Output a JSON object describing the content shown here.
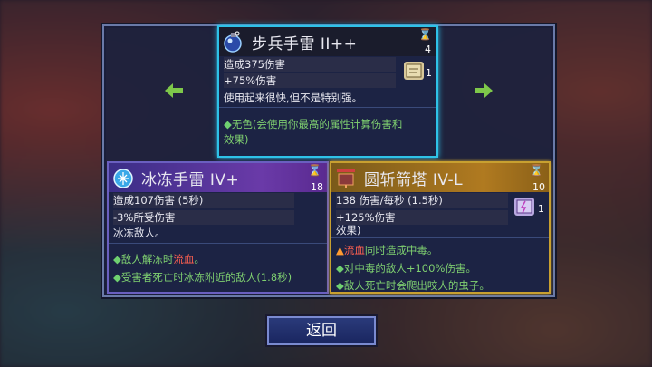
{
  "top_card": {
    "title": "步兵手雷  II++",
    "tier": "4",
    "stat1": "造成375伤害",
    "stat2": "+75%伤害",
    "desc": "使用起来很快,但不是特别强。",
    "scroll_count": "1",
    "note_line1": "无色(会使用你最高的属性计算伤害和",
    "note_line2": "效果)"
  },
  "left_card": {
    "title": "冰冻手雷  IV+",
    "tier": "18",
    "stat1": "造成107伤害 (5秒)",
    "stat2": "-3%所受伤害",
    "desc": "冰冻敌人。",
    "bullet1_a": "敌人解冻时",
    "bullet1_b": "流血",
    "bullet1_c": "。",
    "bullet2": "受害者死亡时冰冻附近的敌人(1.8秒)"
  },
  "right_card": {
    "title": "圆斩箭塔  IV-L",
    "tier": "10",
    "stat1": "138 伤害/每秒 (1.5秒)",
    "stat2": "+125%伤害",
    "desc": "效果)",
    "scroll_count": "1",
    "bullet1_a": "流血",
    "bullet1_b": "同时造成中毒。",
    "bullet2": "对中毒的敌人+100%伤害。",
    "bullet3": "敌人死亡时会爬出咬人的虫子。"
  },
  "back_button": "返回",
  "icons": {
    "left_arrow": "arrow-left-icon",
    "right_arrow": "arrow-right-icon",
    "hourglass": "hourglass-icon",
    "scroll": "scroll-icon"
  },
  "colors": {
    "top_border": "#2ec2e8",
    "left_border": "#6a5fc0",
    "right_border": "#c8a030",
    "bleed_red": "#ff6050"
  }
}
